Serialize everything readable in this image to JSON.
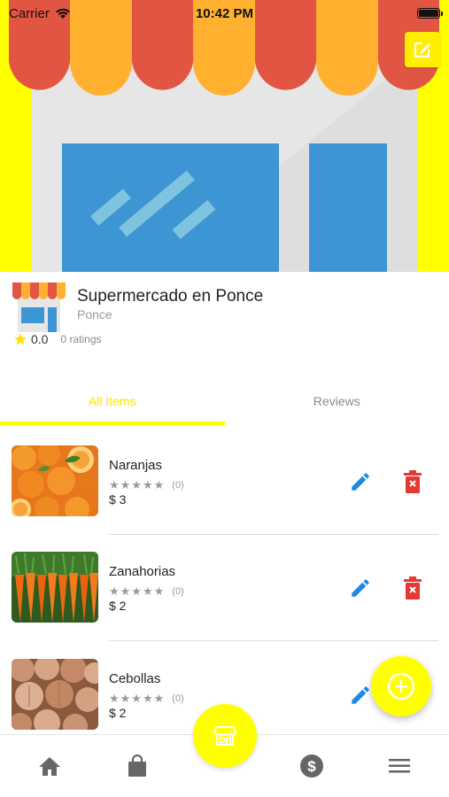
{
  "status_bar": {
    "carrier": "Carrier",
    "time": "10:42 PM"
  },
  "store": {
    "name": "Supermercado en Ponce",
    "city": "Ponce",
    "rating": "0.0",
    "ratings_count": "0 ratings"
  },
  "tabs": [
    {
      "label": "All Items",
      "active": true
    },
    {
      "label": "Reviews",
      "active": false
    }
  ],
  "items": [
    {
      "name": "Naranjas",
      "stars": "★★★★★",
      "review_count": "(0)",
      "price": "$ 3",
      "image": "oranges"
    },
    {
      "name": "Zanahorias",
      "stars": "★★★★★",
      "review_count": "(0)",
      "price": "$ 2",
      "image": "carrots"
    },
    {
      "name": "Cebollas",
      "stars": "★★★★★",
      "review_count": "(0)",
      "price": "$ 2",
      "image": "onions"
    }
  ],
  "bottom_nav": [
    "home-icon",
    "shopping-bag-icon",
    "store-icon",
    "dollar-icon",
    "menu-icon"
  ],
  "colors": {
    "accent": "#ffff00",
    "edit_blue": "#1e88e5",
    "delete_red": "#e53935",
    "nav_gray": "#666666"
  }
}
